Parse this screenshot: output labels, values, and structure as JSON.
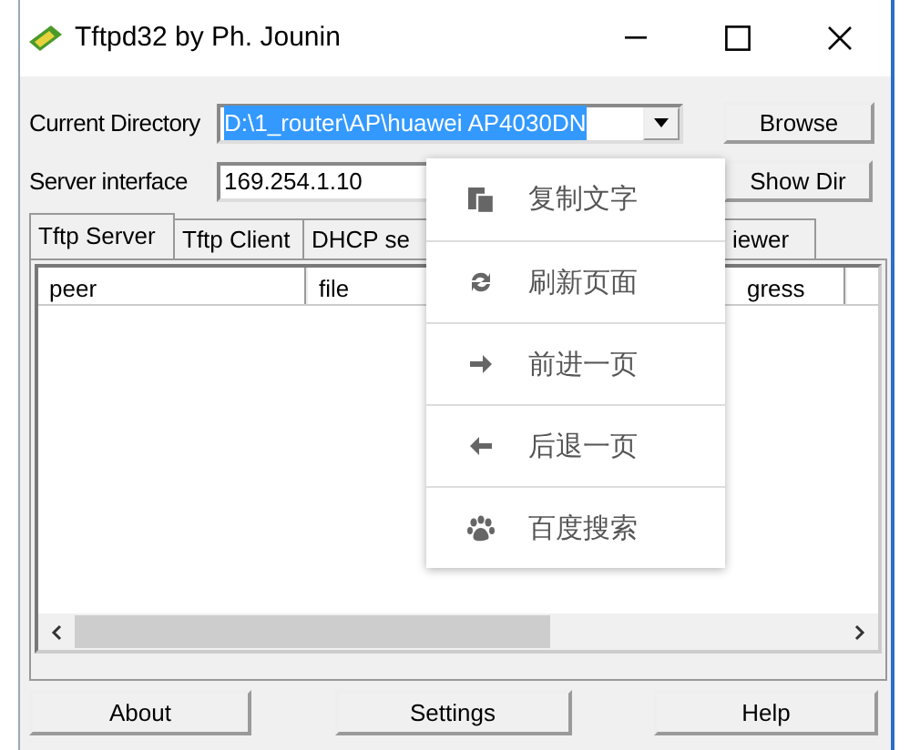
{
  "window": {
    "title": "Tftpd32 by Ph. Jounin"
  },
  "current_directory": {
    "label": "Current Directory",
    "value": "D:\\1_router\\AP\\huawei AP4030DN",
    "selected_text": true,
    "button": "Browse"
  },
  "server_interface": {
    "label": "Server interface",
    "value": "169.254.1.10",
    "button": "Show Dir"
  },
  "tabs": [
    {
      "label": "Tftp Server",
      "selected": true
    },
    {
      "label": "Tftp Client",
      "selected": false
    },
    {
      "label": "DHCP se",
      "selected": false
    },
    {
      "label": "iewer",
      "selected": false
    }
  ],
  "table": {
    "columns": [
      "peer",
      "file",
      "gress"
    ]
  },
  "context_menu": [
    {
      "kind": "copy",
      "label": "复制文字"
    },
    {
      "kind": "refresh",
      "label": "刷新页面"
    },
    {
      "kind": "forward",
      "label": "前进一页"
    },
    {
      "kind": "back",
      "label": "后退一页"
    },
    {
      "kind": "search",
      "label": "百度搜索"
    }
  ],
  "buttons": [
    "About",
    "Settings",
    "Help"
  ]
}
